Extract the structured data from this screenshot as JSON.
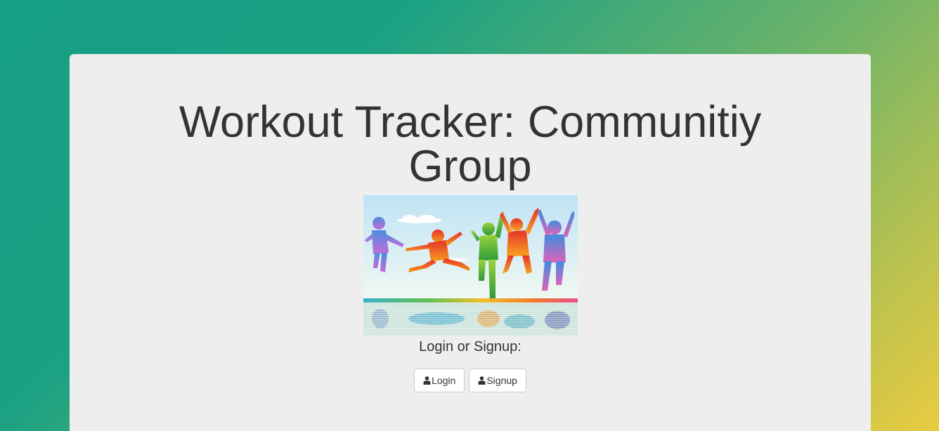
{
  "page": {
    "title": "Workout Tracker: Communitiy Group"
  },
  "hero_image": {
    "alt": "Colorful silhouettes of children jumping"
  },
  "auth": {
    "prompt": "Login or Signup:",
    "login_label": "Login",
    "signup_label": "Signup",
    "icon": "user-icon"
  },
  "colors": {
    "gradient_start": "#16a085",
    "gradient_end": "#e9cb41",
    "panel_bg": "#eeeeee",
    "text": "#333333"
  }
}
